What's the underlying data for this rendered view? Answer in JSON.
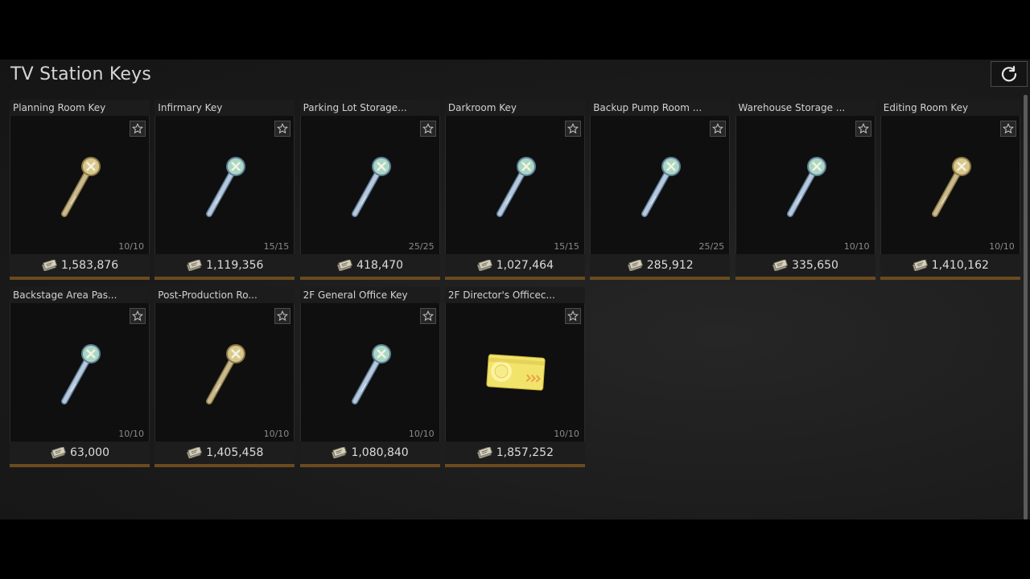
{
  "header": {
    "title": "TV Station Keys"
  },
  "icons": {
    "refresh": "refresh-icon",
    "favorite": "star-icon",
    "currency": "roubles-icon"
  },
  "colors": {
    "accent_bar": "#6b4a1f",
    "gold_key": "#cdbb7f",
    "silver_key": "#b8c8d8"
  },
  "items": [
    {
      "name": "Planning Room Key",
      "count": "10/10",
      "price": "1,583,876",
      "icon": "gold-key-icon"
    },
    {
      "name": "Infirmary Key",
      "count": "15/15",
      "price": "1,119,356",
      "icon": "silver-key-icon"
    },
    {
      "name": "Parking Lot Storage...",
      "count": "25/25",
      "price": "418,470",
      "icon": "silver-key-icon"
    },
    {
      "name": "Darkroom Key",
      "count": "15/15",
      "price": "1,027,464",
      "icon": "silver-key-icon"
    },
    {
      "name": "Backup Pump Room ...",
      "count": "25/25",
      "price": "285,912",
      "icon": "silver-key-icon"
    },
    {
      "name": "Warehouse Storage ...",
      "count": "10/10",
      "price": "335,650",
      "icon": "silver-key-icon"
    },
    {
      "name": "Editing Room Key",
      "count": "10/10",
      "price": "1,410,162",
      "icon": "gold-key-icon"
    },
    {
      "name": "Backstage Area Pas...",
      "count": "10/10",
      "price": "63,000",
      "icon": "silver-key-icon"
    },
    {
      "name": "Post-Production Ro...",
      "count": "10/10",
      "price": "1,405,458",
      "icon": "gold-key-icon"
    },
    {
      "name": "2F General Office Key",
      "count": "10/10",
      "price": "1,080,840",
      "icon": "silver-key-icon"
    },
    {
      "name": "2F Director's Officec...",
      "count": "10/10",
      "price": "1,857,252",
      "icon": "keycard-icon"
    }
  ]
}
